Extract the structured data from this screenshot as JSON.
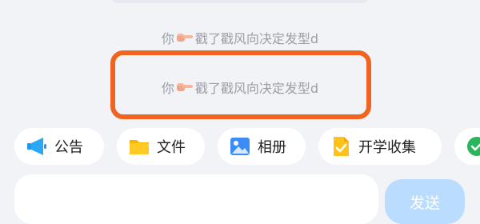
{
  "messages": [
    {
      "user": "你",
      "action": "戳了戳风向决定发型d"
    },
    {
      "user": "你",
      "action": "戳了戳风向决定发型d"
    }
  ],
  "toolbar": {
    "announcement_label": "公告",
    "files_label": "文件",
    "album_label": "相册",
    "collect_label": "开学收集"
  },
  "composer": {
    "input_value": "",
    "send_label": "发送"
  },
  "colors": {
    "highlight": "#f0641f",
    "send_button": "#b9dcff",
    "message_text": "#9a9ea6"
  }
}
